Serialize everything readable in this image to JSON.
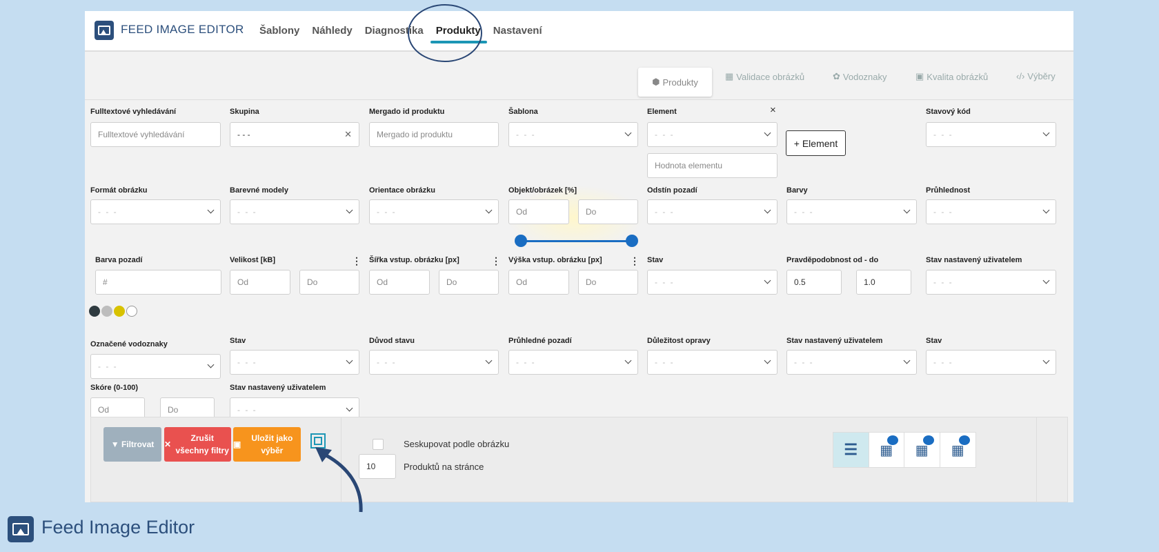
{
  "app": {
    "brand": "FEED IMAGE EDITOR"
  },
  "nav": [
    "Šablony",
    "Náhledy",
    "Diagnostika",
    "Produkty",
    "Nastavení"
  ],
  "subtabs": [
    "Produkty",
    "Validace obrázků",
    "Vodoznaky",
    "Kvalita obrázků",
    "Výběry"
  ],
  "row1": {
    "fulltext_label": "Fulltextové vyhledávání",
    "fulltext_placeholder": "Fulltextové vyhledávání",
    "skupina_label": "Skupina",
    "skupina_value": "- - -",
    "mergado_label": "Mergado id produktu",
    "mergado_placeholder": "Mergado id produktu",
    "sablona_label": "Šablona",
    "element_label": "Element",
    "element_value_placeholder": "Hodnota elementu",
    "add_element": "+ Element",
    "stavovy_label": "Stavový kód"
  },
  "row2": {
    "format_label": "Formát obrázku",
    "barevne_label": "Barevné modely",
    "orientace_label": "Orientace obrázku",
    "objekt_label": "Objekt/obrázek [%]",
    "od": "Od",
    "do": "Do",
    "odstin_label": "Odstín pozadí",
    "barvy_label": "Barvy",
    "pruhlednost_label": "Průhlednost"
  },
  "row3": {
    "barva_label": "Barva pozadí",
    "barva_placeholder": "#",
    "velikost_label": "Velikost [kB]",
    "sirka_label": "Šířka vstup. obrázku [px]",
    "vyska_label": "Výška vstup. obrázku [px]",
    "stav_label": "Stav",
    "pravd_label": "Pravděpodobnost od - do",
    "pravd_from": "0.5",
    "pravd_to": "1.0",
    "stav_user_label": "Stav nastavený uživatelem"
  },
  "swatches": [
    "#2f3b40",
    "#bdbdbd",
    "#d8c200",
    "#ffffff"
  ],
  "row4": {
    "vodoznaky_label": "Označené vodoznaky",
    "stav_label": "Stav",
    "duvod_label": "Důvod stavu",
    "pruhledne_label": "Průhledné pozadí",
    "dulezitost_label": "Důležitost opravy",
    "stav_user_label": "Stav nastavený uživatelem",
    "stav2_label": "Stav"
  },
  "row5": {
    "skore_label": "Skóre (0-100)",
    "stav_user_label": "Stav nastavený uživatelem"
  },
  "select_placeholder": "- - -",
  "actions": {
    "filter": "Filtrovat",
    "cancel": "Zrušit všechny filtry",
    "save": "Uložit jako výběr",
    "group_label": "Seskupovat podle obrázku",
    "per_page_value": "10",
    "per_page_label": "Produktů na stránce"
  },
  "footer": {
    "title": "Feed Image Editor"
  },
  "colors": {
    "brand": "#2c4f7c",
    "accent": "#1c96b5",
    "filter": "#9fb0bd",
    "cancel": "#e9514f",
    "save": "#f7941d"
  }
}
